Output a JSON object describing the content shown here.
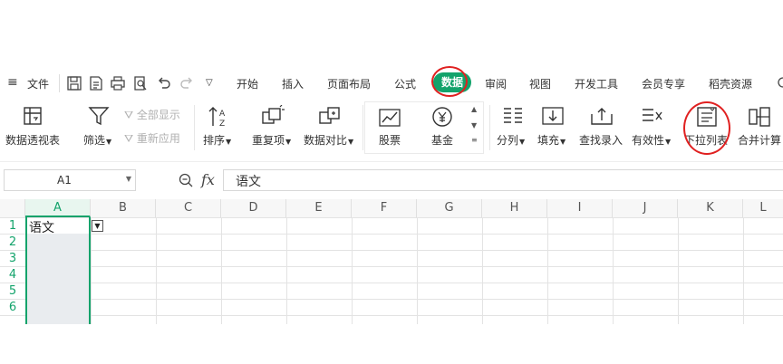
{
  "menubar": {
    "file_label": "文件",
    "tabs": [
      "开始",
      "插入",
      "页面布局",
      "公式",
      "数据",
      "审阅",
      "视图",
      "开发工具",
      "会员专享",
      "稻壳资源"
    ],
    "active_tab": "数据"
  },
  "ribbon": {
    "pivot": "数据透视表",
    "filter": "筛选",
    "show_all": "全部显示",
    "reapply": "重新应用",
    "sort": "排序",
    "duplicates": "重复项",
    "compare": "数据对比",
    "stock": "股票",
    "fund": "基金",
    "split": "分列",
    "fill": "填充",
    "lookup": "查找录入",
    "validity": "有效性",
    "dropdown_list": "下拉列表",
    "merge_calc": "合并计算"
  },
  "formula_bar": {
    "cell_ref": "A1",
    "fx_label": "fx",
    "content": "语文"
  },
  "grid": {
    "columns": [
      "A",
      "B",
      "C",
      "D",
      "E",
      "F",
      "G",
      "H",
      "I",
      "J",
      "K",
      "L"
    ],
    "rows": [
      "1",
      "2",
      "3",
      "4",
      "5",
      "6"
    ],
    "cells": {
      "A1": "语文"
    }
  },
  "colors": {
    "accent": "#13a36b",
    "highlight_ring": "#e02020"
  }
}
